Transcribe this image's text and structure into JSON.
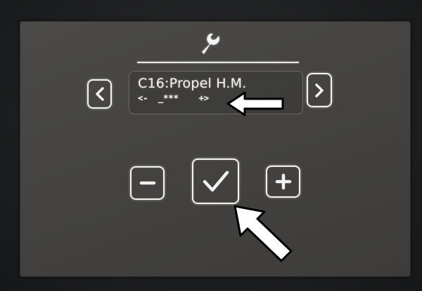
{
  "display": {
    "line1": "C16:Propel H.M.",
    "line2": "<-  _***    +>"
  },
  "icons": {
    "header": "wrench-icon",
    "nav_left": "chevron-left-icon",
    "nav_right": "chevron-right-icon",
    "minus": "minus-icon",
    "confirm": "checkmark-icon",
    "plus": "plus-icon",
    "callouts": [
      "arrow-left-callout-icon",
      "arrow-up-left-callout-icon"
    ]
  },
  "colors": {
    "panel": "#444341",
    "glyph": "#f2f2f2",
    "callout_fill": "#ffffff",
    "callout_stroke": "#000000"
  }
}
